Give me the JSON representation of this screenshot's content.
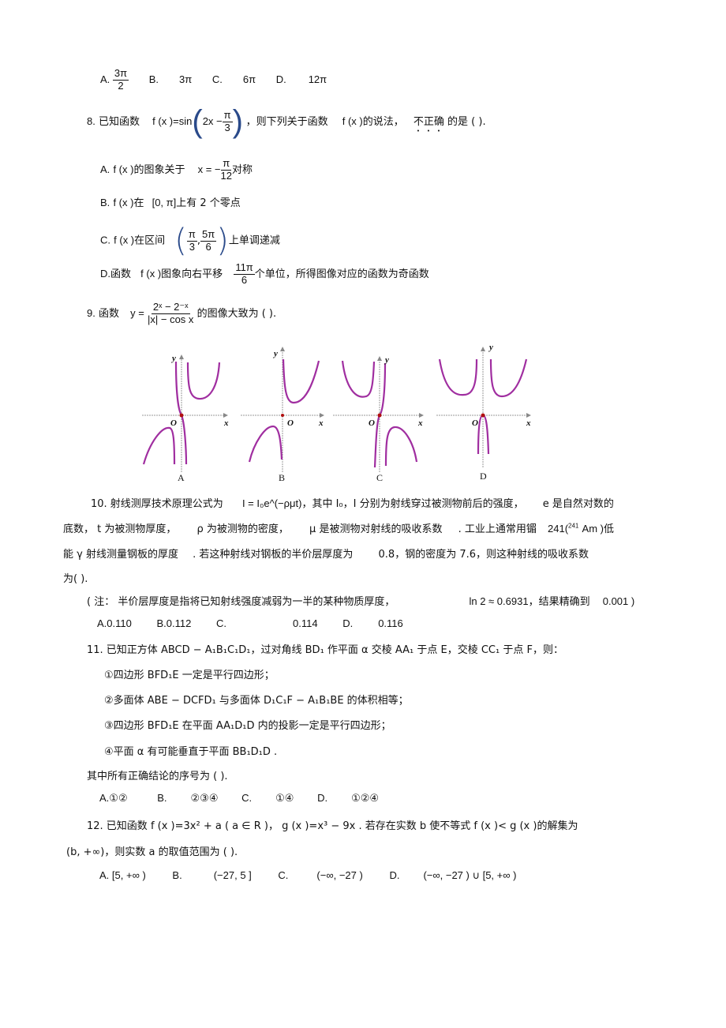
{
  "q7": {
    "options": [
      {
        "label": "A.",
        "num": "3π",
        "den": "2"
      },
      {
        "label": "B.",
        "value": "3π"
      },
      {
        "label": "C.",
        "value": "6π"
      },
      {
        "label": "D.",
        "value": "12π"
      }
    ]
  },
  "q8": {
    "number": "8.",
    "intro": "已知函数",
    "func": "f(x)=sin(2x − π/3)",
    "func_lhs": "f (x )=sin",
    "func_arg": "2x −",
    "func_frac_num": "π",
    "func_frac_den": "3",
    "mid": "，则下列关于函数",
    "fx": "f (x )",
    "tail1": "的说法，",
    "emph": "不正确",
    "tail2": "的是 (    ).",
    "options": [
      {
        "label": "A.",
        "fx": "f (x )",
        "text1": "的图象关于",
        "expr": "x = −",
        "num": "π",
        "den": "12",
        "text2": "对称"
      },
      {
        "label": "B.",
        "fx": "f (x )",
        "text1": "在",
        "interval": "[0,  π]",
        "text2": "上有  2 个零点"
      },
      {
        "label": "C.",
        "fx": "f (x )",
        "text1": "在区间",
        "n1": "π",
        "d1": "3",
        "n2": "5π",
        "d2": "6",
        "text2": "上单调递减"
      },
      {
        "label": "D.",
        "pre": "函数",
        "fx": "f (x )",
        "text1": "图象向右平移",
        "num": "11π",
        "den": "6",
        "text2": "个单位，所得图像对应的函数为奇函数"
      }
    ]
  },
  "q9": {
    "number": "9.",
    "intro": "函数",
    "y": "y =",
    "num": "2ˣ − 2⁻ˣ",
    "den": "|x| − cos x",
    "tail": "的图像大致为  (    ).",
    "graphs": [
      {
        "label": "A",
        "x_axis": "x",
        "y_axis": "y",
        "origin": "O"
      },
      {
        "label": "B",
        "x_axis": "x",
        "y_axis": "y",
        "origin": "O"
      },
      {
        "label": "C",
        "x_axis": "x",
        "y_axis": "y",
        "origin": "O"
      },
      {
        "label": "D",
        "x_axis": "x",
        "y_axis": "y",
        "origin": "O"
      }
    ],
    "curve_color": "#a02ea0",
    "origin_color": "#b01010"
  },
  "q10": {
    "line1_a": "10. 射线测厚技术原理公式为",
    "formula": "I = I₀e^(−ρμt)",
    "line1_b": "，其中 I₀，I 分别为射线穿过被测物前后的强度，",
    "line1_c": "e 是自然对数的",
    "line2_a": "底数，  t 为被测物厚度，",
    "line2_b": "ρ 为被测物的密度，",
    "line2_c": "μ 是被测物对射线的吸收系数",
    "line2_d": ". 工业上通常用镅",
    "line2_e": "241(",
    "line2_f": "241",
    "line2_g": "Am )低",
    "line3_a": "能  γ 射线测量钢板的厚度",
    "line3_b": ". 若这种射线对钢板的半价层厚度为",
    "line3_c": "0.8，钢的密度为  7.6，则这种射线的吸收系数",
    "line4": "为(    ).",
    "note_a": "( 注： 半价层厚度是指将已知射线强度减弱为一半的某种物质厚度，",
    "note_b": "ln 2 ≈ 0.6931",
    "note_c": "，结果精确到",
    "note_d": "0.001 )",
    "options": [
      {
        "label": "A.",
        "value": "0.110"
      },
      {
        "label": "B.",
        "value": "0.112"
      },
      {
        "label": "C.",
        "value": "0.114"
      },
      {
        "label": "D.",
        "value": "0.116"
      }
    ]
  },
  "q11": {
    "line1": "11. 已知正方体  ABCD − A₁B₁C₁D₁，过对角线  BD₁ 作平面  α 交棱  AA₁ 于点  E，交棱  CC₁ 于点  F，则：",
    "items": [
      "①四边形  BFD₁E 一定是平行四边形；",
      "②多面体  ABE − DCFD₁ 与多面体  D₁C₁F − A₁B₁BE 的体积相等；",
      "③四边形  BFD₁E 在平面  AA₁D₁D 内的投影一定是平行四边形；",
      "④平面  α 有可能垂直于平面    BB₁D₁D ."
    ],
    "question": "其中所有正确结论的序号为    (    ).",
    "options": [
      {
        "label": "A.",
        "value": "①②"
      },
      {
        "label": "B.",
        "value": "②③④"
      },
      {
        "label": "C.",
        "value": "①④"
      },
      {
        "label": "D.",
        "value": "①②④"
      }
    ]
  },
  "q12": {
    "line1": "12. 已知函数  f (x )=3x² + a ( a ∈ R )，  g (x )=x³ − 9x  . 若存在实数  b 使不等式  f (x )< g (x )的解集为",
    "line2": "(b,  +∞)，则实数  a 的取值范围为  (    ).",
    "options": [
      {
        "label": "A.",
        "value": "[5,  +∞ )"
      },
      {
        "label": "B.",
        "value": "(−27, 5 ]"
      },
      {
        "label": "C.",
        "value": "(−∞,  −27 )"
      },
      {
        "label": "D.",
        "value": "(−∞,  −27 ) ∪ [5,  +∞ )"
      }
    ]
  }
}
